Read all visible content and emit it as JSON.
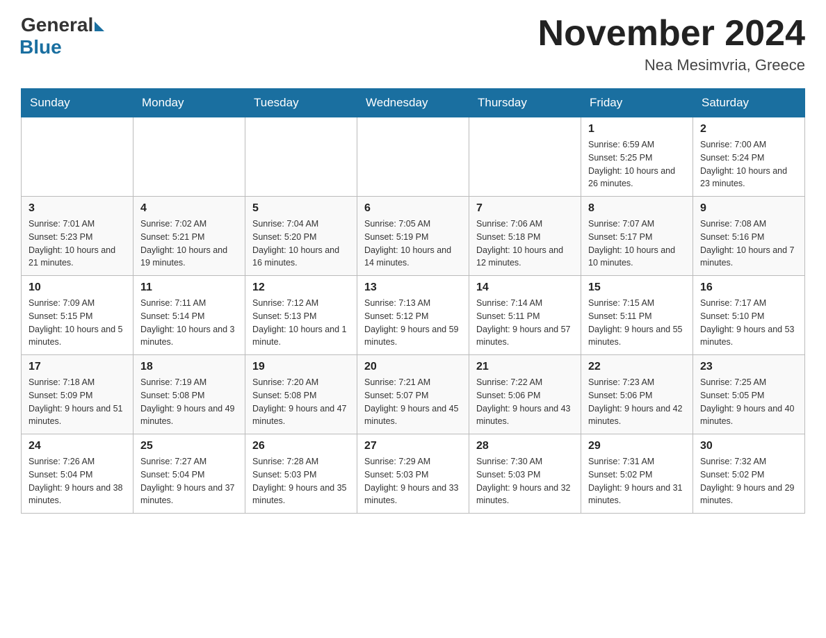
{
  "header": {
    "logo_general": "General",
    "logo_blue": "Blue",
    "month_title": "November 2024",
    "location": "Nea Mesimvria, Greece"
  },
  "days_of_week": [
    "Sunday",
    "Monday",
    "Tuesday",
    "Wednesday",
    "Thursday",
    "Friday",
    "Saturday"
  ],
  "weeks": [
    [
      {
        "day": "",
        "info": ""
      },
      {
        "day": "",
        "info": ""
      },
      {
        "day": "",
        "info": ""
      },
      {
        "day": "",
        "info": ""
      },
      {
        "day": "",
        "info": ""
      },
      {
        "day": "1",
        "info": "Sunrise: 6:59 AM\nSunset: 5:25 PM\nDaylight: 10 hours and 26 minutes."
      },
      {
        "day": "2",
        "info": "Sunrise: 7:00 AM\nSunset: 5:24 PM\nDaylight: 10 hours and 23 minutes."
      }
    ],
    [
      {
        "day": "3",
        "info": "Sunrise: 7:01 AM\nSunset: 5:23 PM\nDaylight: 10 hours and 21 minutes."
      },
      {
        "day": "4",
        "info": "Sunrise: 7:02 AM\nSunset: 5:21 PM\nDaylight: 10 hours and 19 minutes."
      },
      {
        "day": "5",
        "info": "Sunrise: 7:04 AM\nSunset: 5:20 PM\nDaylight: 10 hours and 16 minutes."
      },
      {
        "day": "6",
        "info": "Sunrise: 7:05 AM\nSunset: 5:19 PM\nDaylight: 10 hours and 14 minutes."
      },
      {
        "day": "7",
        "info": "Sunrise: 7:06 AM\nSunset: 5:18 PM\nDaylight: 10 hours and 12 minutes."
      },
      {
        "day": "8",
        "info": "Sunrise: 7:07 AM\nSunset: 5:17 PM\nDaylight: 10 hours and 10 minutes."
      },
      {
        "day": "9",
        "info": "Sunrise: 7:08 AM\nSunset: 5:16 PM\nDaylight: 10 hours and 7 minutes."
      }
    ],
    [
      {
        "day": "10",
        "info": "Sunrise: 7:09 AM\nSunset: 5:15 PM\nDaylight: 10 hours and 5 minutes."
      },
      {
        "day": "11",
        "info": "Sunrise: 7:11 AM\nSunset: 5:14 PM\nDaylight: 10 hours and 3 minutes."
      },
      {
        "day": "12",
        "info": "Sunrise: 7:12 AM\nSunset: 5:13 PM\nDaylight: 10 hours and 1 minute."
      },
      {
        "day": "13",
        "info": "Sunrise: 7:13 AM\nSunset: 5:12 PM\nDaylight: 9 hours and 59 minutes."
      },
      {
        "day": "14",
        "info": "Sunrise: 7:14 AM\nSunset: 5:11 PM\nDaylight: 9 hours and 57 minutes."
      },
      {
        "day": "15",
        "info": "Sunrise: 7:15 AM\nSunset: 5:11 PM\nDaylight: 9 hours and 55 minutes."
      },
      {
        "day": "16",
        "info": "Sunrise: 7:17 AM\nSunset: 5:10 PM\nDaylight: 9 hours and 53 minutes."
      }
    ],
    [
      {
        "day": "17",
        "info": "Sunrise: 7:18 AM\nSunset: 5:09 PM\nDaylight: 9 hours and 51 minutes."
      },
      {
        "day": "18",
        "info": "Sunrise: 7:19 AM\nSunset: 5:08 PM\nDaylight: 9 hours and 49 minutes."
      },
      {
        "day": "19",
        "info": "Sunrise: 7:20 AM\nSunset: 5:08 PM\nDaylight: 9 hours and 47 minutes."
      },
      {
        "day": "20",
        "info": "Sunrise: 7:21 AM\nSunset: 5:07 PM\nDaylight: 9 hours and 45 minutes."
      },
      {
        "day": "21",
        "info": "Sunrise: 7:22 AM\nSunset: 5:06 PM\nDaylight: 9 hours and 43 minutes."
      },
      {
        "day": "22",
        "info": "Sunrise: 7:23 AM\nSunset: 5:06 PM\nDaylight: 9 hours and 42 minutes."
      },
      {
        "day": "23",
        "info": "Sunrise: 7:25 AM\nSunset: 5:05 PM\nDaylight: 9 hours and 40 minutes."
      }
    ],
    [
      {
        "day": "24",
        "info": "Sunrise: 7:26 AM\nSunset: 5:04 PM\nDaylight: 9 hours and 38 minutes."
      },
      {
        "day": "25",
        "info": "Sunrise: 7:27 AM\nSunset: 5:04 PM\nDaylight: 9 hours and 37 minutes."
      },
      {
        "day": "26",
        "info": "Sunrise: 7:28 AM\nSunset: 5:03 PM\nDaylight: 9 hours and 35 minutes."
      },
      {
        "day": "27",
        "info": "Sunrise: 7:29 AM\nSunset: 5:03 PM\nDaylight: 9 hours and 33 minutes."
      },
      {
        "day": "28",
        "info": "Sunrise: 7:30 AM\nSunset: 5:03 PM\nDaylight: 9 hours and 32 minutes."
      },
      {
        "day": "29",
        "info": "Sunrise: 7:31 AM\nSunset: 5:02 PM\nDaylight: 9 hours and 31 minutes."
      },
      {
        "day": "30",
        "info": "Sunrise: 7:32 AM\nSunset: 5:02 PM\nDaylight: 9 hours and 29 minutes."
      }
    ]
  ]
}
